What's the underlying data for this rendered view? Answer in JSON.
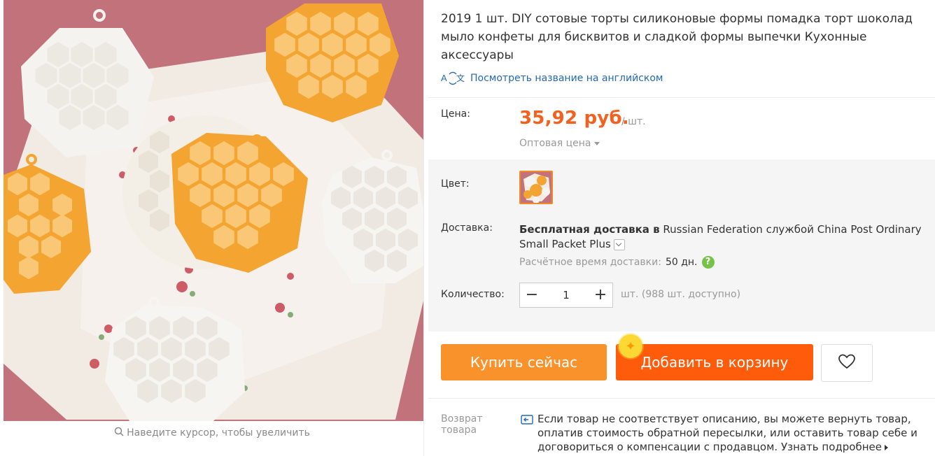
{
  "gallery": {
    "zoom_hint": "Наведите курсор, чтобы увеличить",
    "image_alt": "honeycomb silicone molds"
  },
  "product": {
    "title": "2019 1 шт. DIY сотовые торты силиконовые формы помадка торт шоколад мыло конфеты для бисквитов и сладкой формы выпечки Кухонные аксессуары",
    "translate_link": "Посмотреть название на английском"
  },
  "price": {
    "label": "Цена:",
    "value": "35,92 руб.",
    "per_unit": "/ шт.",
    "wholesale": "Оптовая цена"
  },
  "color": {
    "label": "Цвет:"
  },
  "shipping": {
    "label": "Доставка:",
    "free_prefix": "Бесплатная доставка в",
    "rest": " Russian Federation службой China Post Ordinary Small Packet Plus",
    "est_label": "Расчётное время доставки:",
    "est_days": "50 дн.",
    "help": "?"
  },
  "quantity": {
    "label": "Количество:",
    "value": "1",
    "minus": "−",
    "plus": "+",
    "available": "шт. (988 шт. доступно)"
  },
  "actions": {
    "buy_now": "Купить сейчас",
    "add_to_cart": "Добавить в корзину",
    "star": "✦"
  },
  "returns": {
    "label_line1": "Возврат",
    "label_line2": "товара",
    "text": "Если товар не соответствует описанию, вы можете вернуть товар, оплатив стоимость обратной пересылки, или оставить товар себе и договориться о компенсации с продавцом.",
    "more": "Узнать подробнее"
  },
  "colors": {
    "accent_orange": "#f4611e",
    "buy_button": "#fa922c",
    "cart_button": "#fe5c0b",
    "link_blue": "#2469b4",
    "help_green": "#77c34a"
  }
}
